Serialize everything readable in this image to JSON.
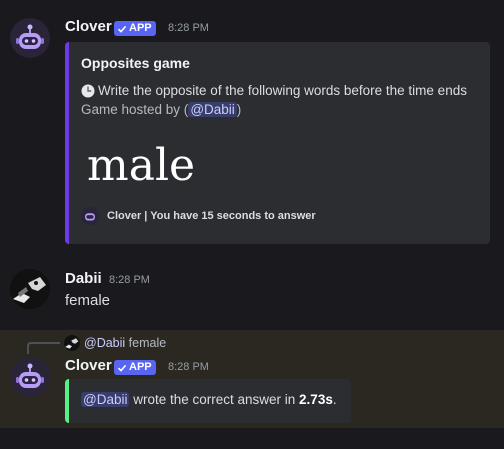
{
  "messages": [
    {
      "author": "Clover",
      "badge": "APP",
      "time": "8:28 PM",
      "embed": {
        "title": "Opposites game",
        "clock_icon": "clock-icon",
        "description": "Write the opposite of the following words before the time ends",
        "hosted_prefix": "Game hosted by (",
        "hosted_mention": "@Dabii",
        "hosted_suffix": ")",
        "word": "male",
        "footer": "Clover | You have 15 seconds to answer",
        "accent_color": "#6c3ae6"
      }
    },
    {
      "author": "Dabii",
      "time": "8:28 PM",
      "content": "female"
    },
    {
      "reply": {
        "mention": "@Dabii",
        "text": "female"
      },
      "author": "Clover",
      "badge": "APP",
      "time": "8:28 PM",
      "embed": {
        "mention": "@Dabii",
        "text_before": " wrote the correct answer in ",
        "answer_time": "2.73s",
        "text_after": ".",
        "accent_color": "#57f287"
      }
    }
  ],
  "colors": {
    "background": "#1a1a1e",
    "embed_bg": "#2b2d31",
    "badge": "#5865f2",
    "highlight": "#2b2822"
  }
}
